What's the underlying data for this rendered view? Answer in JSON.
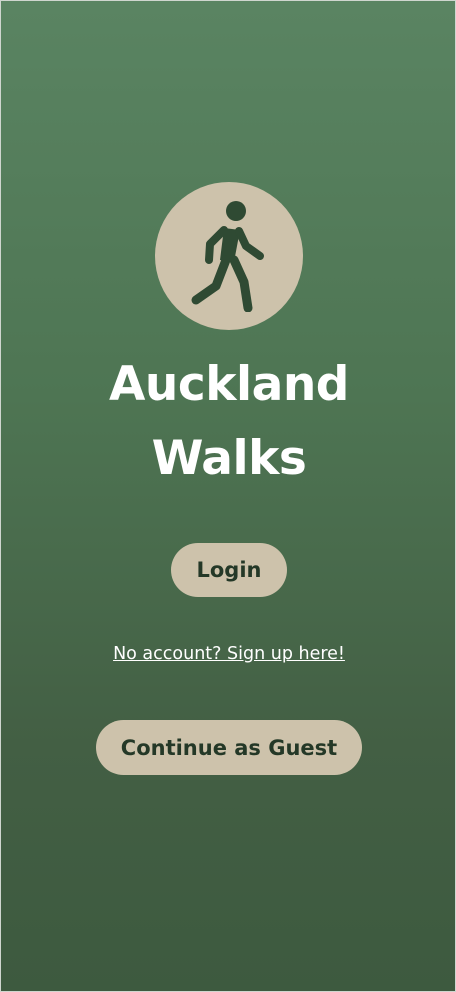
{
  "app": {
    "title_line1": "Auckland",
    "title_line2": "Walks"
  },
  "logo": {
    "icon": "person-walking-icon",
    "background_color": "#cdc2ab",
    "icon_color": "#2f4a33"
  },
  "actions": {
    "login_label": "Login",
    "signup_link_text": "No account? Sign up here!",
    "guest_label": "Continue as Guest"
  },
  "colors": {
    "background_top": "#5a8462",
    "background_bottom": "#3d5a3f",
    "button_background": "#cdc2ab",
    "button_text": "#243827",
    "title_text": "#ffffff"
  }
}
